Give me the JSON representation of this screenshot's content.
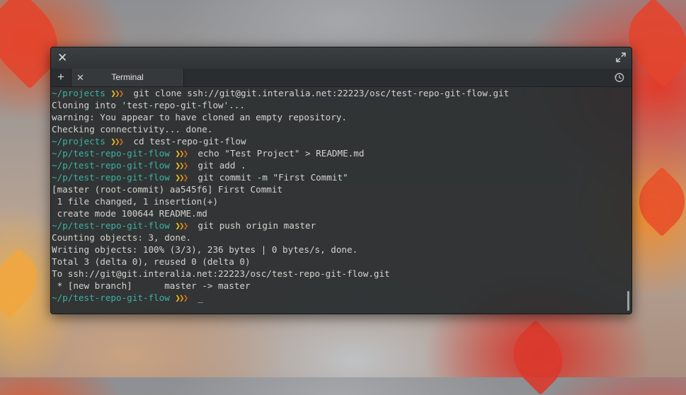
{
  "window": {
    "tab_title": "Terminal"
  },
  "prompt_arrows": [
    "❯",
    "❯",
    "❯"
  ],
  "terminal_lines": [
    {
      "kind": "prompt",
      "cwd": "~/projects",
      "cmd": "git clone ssh://git@git.interalia.net:22223/osc/test-repo-git-flow.git"
    },
    {
      "kind": "output",
      "text": "Cloning into 'test-repo-git-flow'..."
    },
    {
      "kind": "output",
      "text": "warning: You appear to have cloned an empty repository."
    },
    {
      "kind": "output",
      "text": "Checking connectivity... done."
    },
    {
      "kind": "prompt",
      "cwd": "~/projects",
      "cmd": "cd test-repo-git-flow"
    },
    {
      "kind": "prompt",
      "cwd": "~/p/test-repo-git-flow",
      "cmd": "echo \"Test Project\" > README.md"
    },
    {
      "kind": "prompt",
      "cwd": "~/p/test-repo-git-flow",
      "cmd": "git add ."
    },
    {
      "kind": "prompt",
      "cwd": "~/p/test-repo-git-flow",
      "cmd": "git commit -m \"First Commit\""
    },
    {
      "kind": "output",
      "text": "[master (root-commit) aa545f6] First Commit"
    },
    {
      "kind": "output",
      "text": " 1 file changed, 1 insertion(+)"
    },
    {
      "kind": "output",
      "text": " create mode 100644 README.md"
    },
    {
      "kind": "prompt",
      "cwd": "~/p/test-repo-git-flow",
      "cmd": "git push origin master"
    },
    {
      "kind": "output",
      "text": "Counting objects: 3, done."
    },
    {
      "kind": "output",
      "text": "Writing objects: 100% (3/3), 236 bytes | 0 bytes/s, done."
    },
    {
      "kind": "output",
      "text": "Total 3 (delta 0), reused 0 (delta 0)"
    },
    {
      "kind": "output",
      "text": "To ssh://git@git.interalia.net:22223/osc/test-repo-git-flow.git"
    },
    {
      "kind": "output",
      "text": " * [new branch]      master -> master"
    },
    {
      "kind": "prompt",
      "cwd": "~/p/test-repo-git-flow",
      "cmd": "_"
    }
  ],
  "colors": {
    "prompt_cwd": "#3bb2a4",
    "arrow_1": "#f0c419",
    "arrow_2": "#e39a1c",
    "arrow_3": "#cf6a1f",
    "terminal_text": "#d4d4d0",
    "terminal_bg": "#282c2e"
  },
  "icons": {
    "window_close": "close-icon",
    "maximize": "maximize-icon",
    "new_tab": "plus-icon",
    "tab_close": "close-icon",
    "history": "history-icon"
  }
}
